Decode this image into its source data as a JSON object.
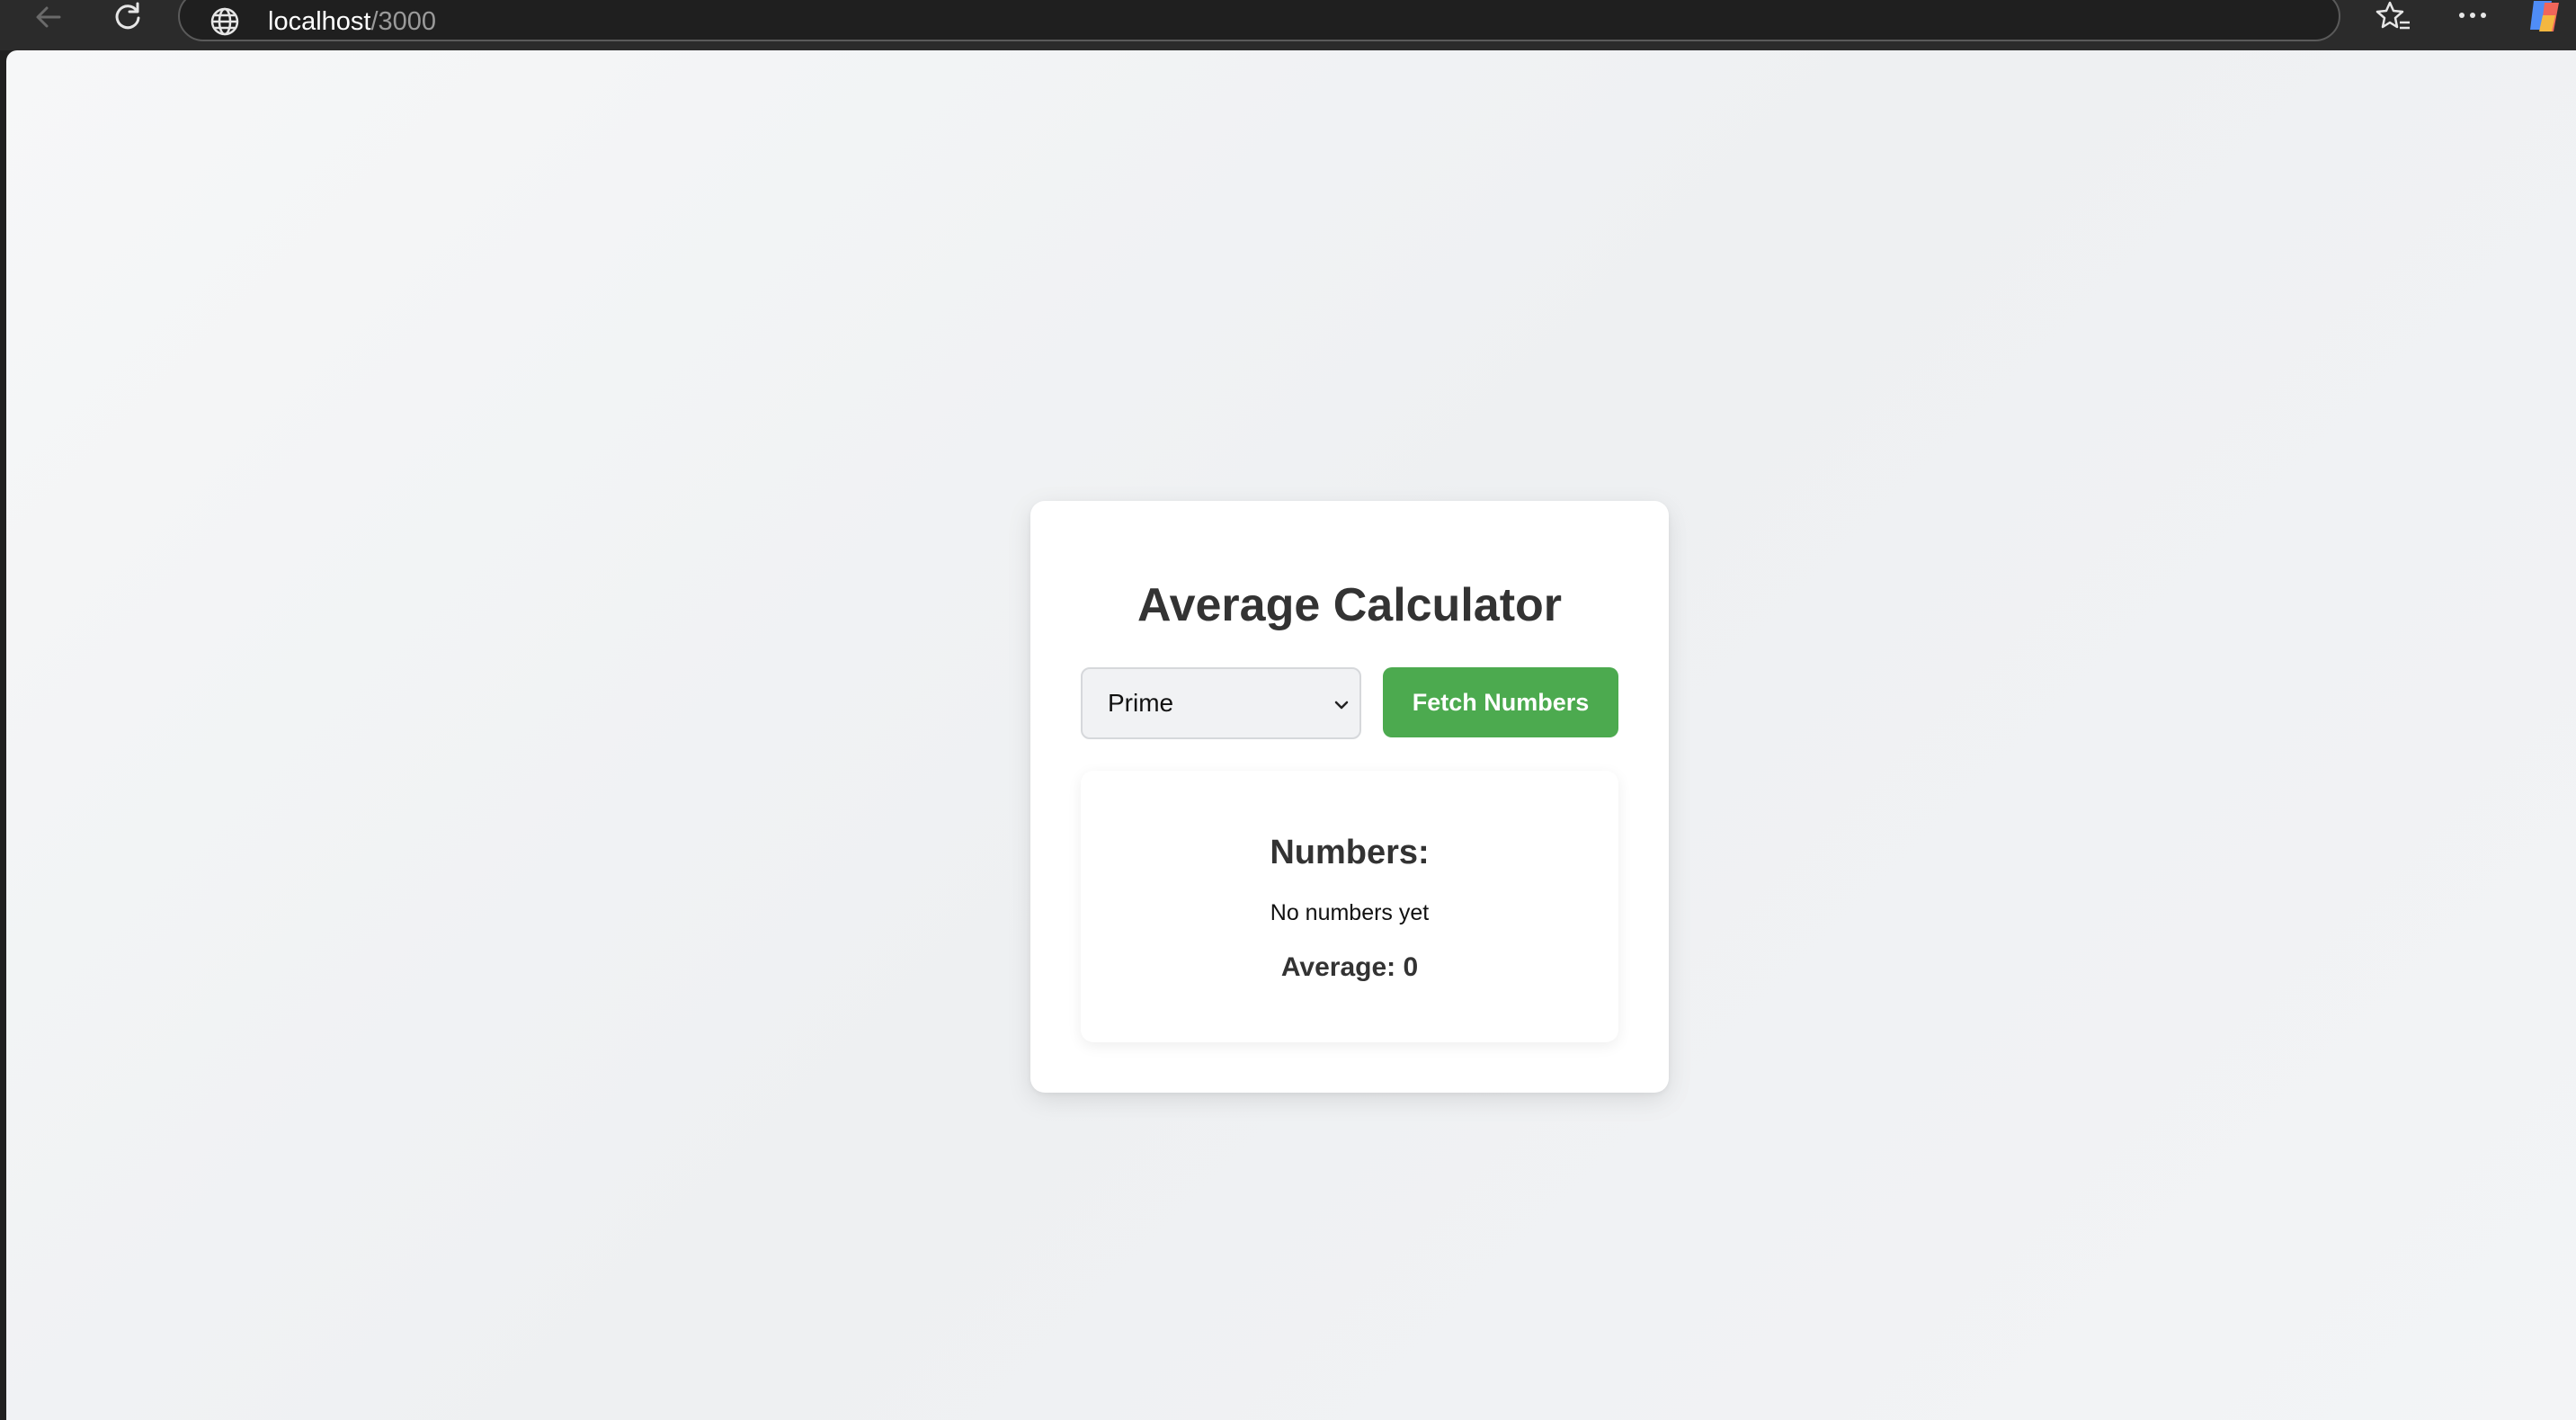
{
  "browser": {
    "url_host": "localhost",
    "url_path": "/3000",
    "back_icon": "arrow-left-icon",
    "reload_icon": "reload-icon",
    "site_icon": "globe-icon",
    "favorites_icon": "star-list-icon",
    "menu_icon": "more-icon",
    "copilot_icon": "copilot-icon"
  },
  "app": {
    "title": "Average Calculator",
    "select": {
      "selected": "Prime"
    },
    "fetch_button_label": "Fetch Numbers",
    "results": {
      "heading": "Numbers:",
      "empty_text": "No numbers yet",
      "average_label": "Average: 0"
    }
  },
  "colors": {
    "accent": "#4caa4f",
    "text": "#333333",
    "background": "#f3f4f6"
  }
}
